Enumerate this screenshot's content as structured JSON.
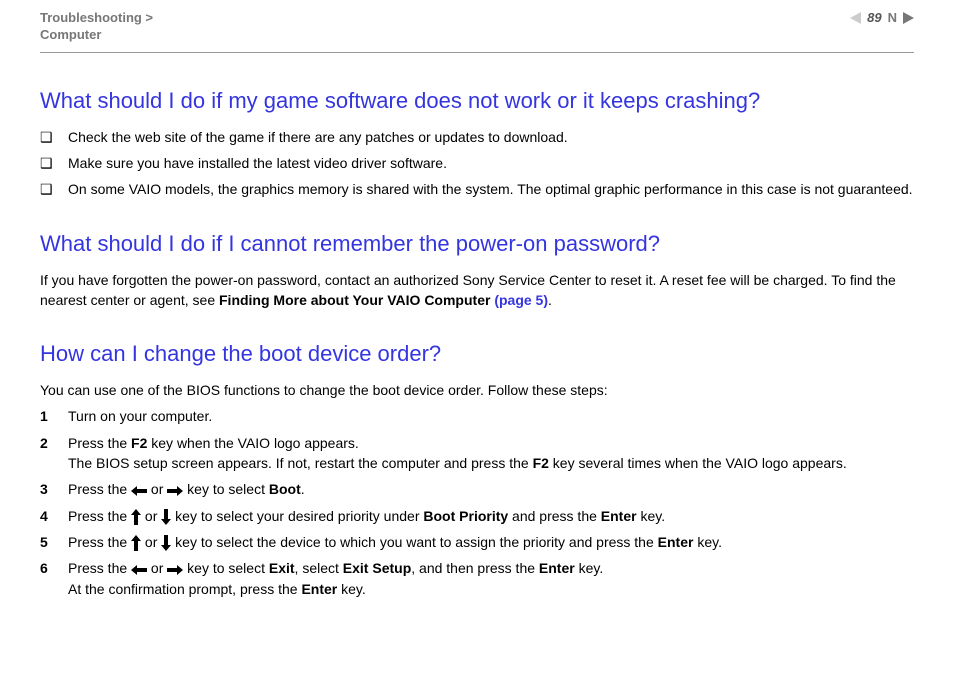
{
  "header": {
    "breadcrumb_line1": "Troubleshooting >",
    "breadcrumb_line2": "Computer",
    "page_number": "89",
    "n_letter": "N",
    "n_letter_mirror": "n"
  },
  "sections": {
    "q1": {
      "title": "What should I do if my game software does not work or it keeps crashing?",
      "bullets": [
        "Check the web site of the game if there are any patches or updates to download.",
        "Make sure you have installed the latest video driver software.",
        "On some VAIO models, the graphics memory is shared with the system. The optimal graphic performance in this case is not guaranteed."
      ]
    },
    "q2": {
      "title": "What should I do if I cannot remember the power-on password?",
      "body_pre": "If you have forgotten the power-on password, contact an authorized Sony Service Center to reset it. A reset fee will be charged. To find the nearest center or agent, see ",
      "body_bold": "Finding More about Your VAIO Computer ",
      "body_link": "(page 5)",
      "body_post": "."
    },
    "q3": {
      "title": "How can I change the boot device order?",
      "intro": "You can use one of the BIOS functions to change the boot device order. Follow these steps:",
      "steps": {
        "s1_num": "1",
        "s1_text": "Turn on your computer.",
        "s2_num": "2",
        "s2_a": "Press the ",
        "s2_b": "F2",
        "s2_c": " key when the VAIO logo appears.",
        "s2_d": "The BIOS setup screen appears. If not, restart the computer and press the ",
        "s2_e": "F2",
        "s2_f": " key several times when the VAIO logo appears.",
        "s3_num": "3",
        "s3_a": "Press the ",
        "s3_b": " or ",
        "s3_c": " key to select ",
        "s3_d": "Boot",
        "s3_e": ".",
        "s4_num": "4",
        "s4_a": "Press the ",
        "s4_b": " or ",
        "s4_c": " key to select your desired priority under ",
        "s4_d": "Boot Priority",
        "s4_e": " and press the ",
        "s4_f": "Enter",
        "s4_g": " key.",
        "s5_num": "5",
        "s5_a": "Press the ",
        "s5_b": " or ",
        "s5_c": " key to select the device to which you want to assign the priority and press the ",
        "s5_d": "Enter",
        "s5_e": " key.",
        "s6_num": "6",
        "s6_a": "Press the ",
        "s6_b": " or ",
        "s6_c": " key to select ",
        "s6_d": "Exit",
        "s6_e": ", select ",
        "s6_f": "Exit Setup",
        "s6_g": ", and then press the ",
        "s6_h": "Enter",
        "s6_i": " key.",
        "s6_j": "At the confirmation prompt, press the ",
        "s6_k": "Enter",
        "s6_l": " key."
      }
    }
  }
}
